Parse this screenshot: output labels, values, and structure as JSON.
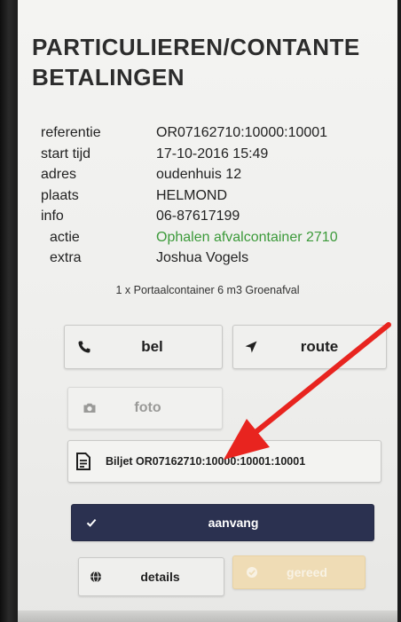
{
  "header": {
    "title_line1": "PARTICULIEREN/CONTANTE",
    "title_line2": "BETALINGEN"
  },
  "details": [
    {
      "label": "referentie",
      "value": "OR07162710:10000:10001"
    },
    {
      "label": "start tijd",
      "value": "17-10-2016 15:49"
    },
    {
      "label": "adres",
      "value": "oudenhuis 12"
    },
    {
      "label": "plaats",
      "value": "HELMOND"
    },
    {
      "label": "info",
      "value": "06-87617199"
    },
    {
      "label": "actie",
      "value": "Ophalen afvalcontainer 2710"
    },
    {
      "label": "extra",
      "value": "Joshua Vogels"
    }
  ],
  "item_line": "1 x Portaalcontainer 6 m3 Groenafval",
  "buttons": {
    "bel": "bel",
    "route": "route",
    "foto": "foto",
    "biljet": "Biljet OR07162710:10000:10001:10001",
    "aanvang": "aanvang",
    "details": "details",
    "gereed": "gereed"
  },
  "colors": {
    "accent_green": "#3c9a3a",
    "primary_button": "#2b3150",
    "gereed_button": "#efdcb5",
    "arrow": "#e8241f"
  },
  "icons": {
    "bel": "phone-icon",
    "route": "navigation-arrow-icon",
    "foto": "camera-icon",
    "biljet": "document-icon",
    "aanvang": "checkmark-icon",
    "details": "globe-icon",
    "gereed": "check-circle-icon"
  }
}
